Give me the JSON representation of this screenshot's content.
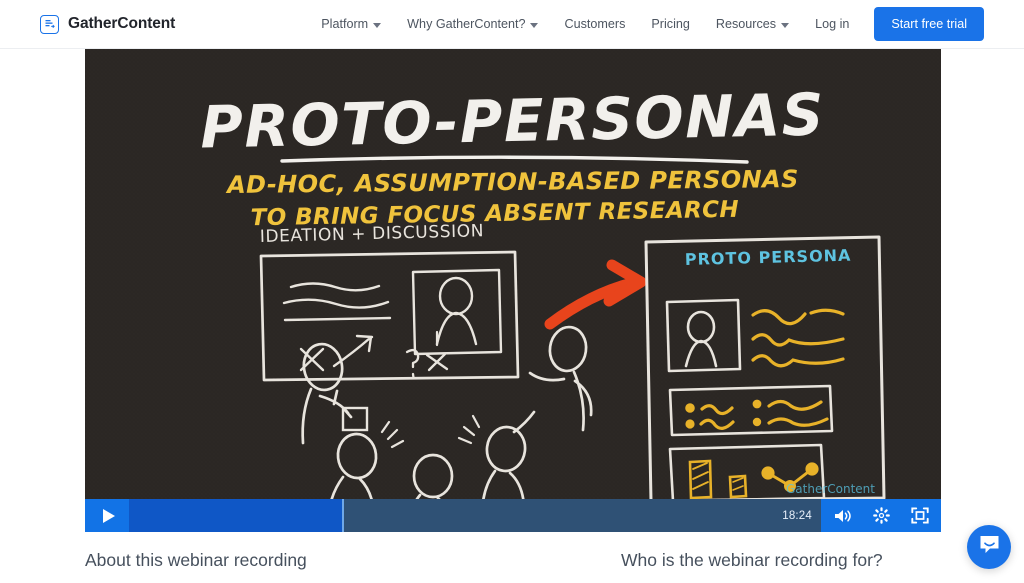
{
  "header": {
    "brand_name": "GatherContent",
    "brand_icon": "document-list-icon",
    "nav": [
      {
        "label": "Platform",
        "has_caret": true
      },
      {
        "label": "Why GatherContent?",
        "has_caret": true
      },
      {
        "label": "Customers",
        "has_caret": false
      },
      {
        "label": "Pricing",
        "has_caret": false
      },
      {
        "label": "Resources",
        "has_caret": true
      },
      {
        "label": "Log in",
        "has_caret": false
      }
    ],
    "cta_label": "Start free trial",
    "accent_color": "#1a73e8"
  },
  "video": {
    "background_color": "#2b2724",
    "slide": {
      "title": "PROTO-PERSONAS",
      "subtitle_line1": "AD-HOC, ASSUMPTION-BASED PERSONAS",
      "subtitle_line2": "TO BRING FOCUS ABSENT RESEARCH",
      "left_panel_label": "IDEATION + DISCUSSION",
      "right_panel_label": "PROTO PERSONA",
      "title_color": "#f2f0ec",
      "subtitle_color": "#f0c33c",
      "right_label_color": "#5ec3e0",
      "arrow_color": "#e8441c",
      "sketch_color": "#e8e4dd",
      "accent_scribble_color": "#e8b229"
    },
    "controls": {
      "play_label": "Play",
      "play_icon": "play-icon",
      "current_time": "18:24",
      "progress_percent": 31,
      "volume_icon": "volume-icon",
      "settings_icon": "gear-icon",
      "fullscreen_icon": "fullscreen-icon",
      "bar_color": "#1273e6",
      "track_color": "#2f5175",
      "fill_color": "#0f57c6"
    }
  },
  "content": {
    "about_heading": "About this webinar recording",
    "audience_heading": "Who is the webinar recording for?"
  },
  "chat": {
    "icon": "chat-bubble-icon",
    "color": "#1a73e8"
  }
}
